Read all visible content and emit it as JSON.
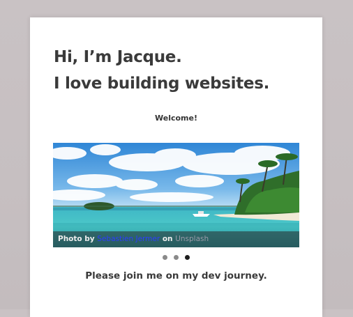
{
  "hero": {
    "line1": "Hi, I’m Jacque.",
    "line2": "I love building websites."
  },
  "welcome": "Welcome!",
  "carousel": {
    "slides": 3,
    "active_index": 2,
    "image_description": "tropical beach with turquoise water",
    "caption": {
      "prefix": "Photo by",
      "author": "Sebastien Jermer",
      "middle": "on",
      "source": "Unsplash"
    }
  },
  "tagline": "Please join me on my dev journey.",
  "colors": {
    "author_link": "#2c3cff",
    "source_link": "#9a9aa8",
    "heading": "#3a3a3a"
  }
}
